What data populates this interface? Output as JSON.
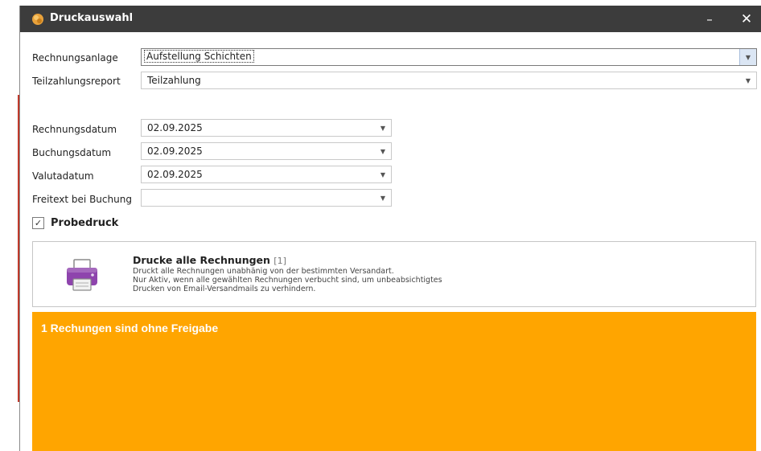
{
  "window": {
    "title": "Druckauswahl",
    "minimize_glyph": "–",
    "close_glyph": "✕"
  },
  "form": {
    "rechnungsanlage": {
      "label": "Rechnungsanlage",
      "value": "Aufstellung Schichten"
    },
    "teilzahlungsreport": {
      "label": "Teilzahlungsreport",
      "value": "Teilzahlung"
    },
    "rechnungsdatum": {
      "label": "Rechnungsdatum",
      "value": "02.09.2025"
    },
    "buchungsdatum": {
      "label": "Buchungsdatum",
      "value": "02.09.2025"
    },
    "valutadatum": {
      "label": "Valutadatum",
      "value": "02.09.2025"
    },
    "freitext": {
      "label": "Freitext bei Buchung",
      "value": ""
    },
    "probedruck": {
      "label": "Probedruck",
      "checked": true,
      "check_glyph": "✓"
    }
  },
  "print_all": {
    "title": "Drucke alle Rechnungen",
    "count": "[1]",
    "description_lines": [
      "Druckt alle Rechnungen unabhänig von der bestimmten Versandart.",
      "Nur Aktiv, wenn alle gewählten Rechnungen verbucht sind, um unbeabsichtigtes",
      "Drucken von Email-Versandmails zu verhindern."
    ],
    "icon": "printer-icon"
  },
  "warning": {
    "text": "1 Rechungen sind ohne Freigabe",
    "color": "#ffa500"
  },
  "colors": {
    "titlebar": "#3c3c3c",
    "accent": "#ffa500"
  }
}
